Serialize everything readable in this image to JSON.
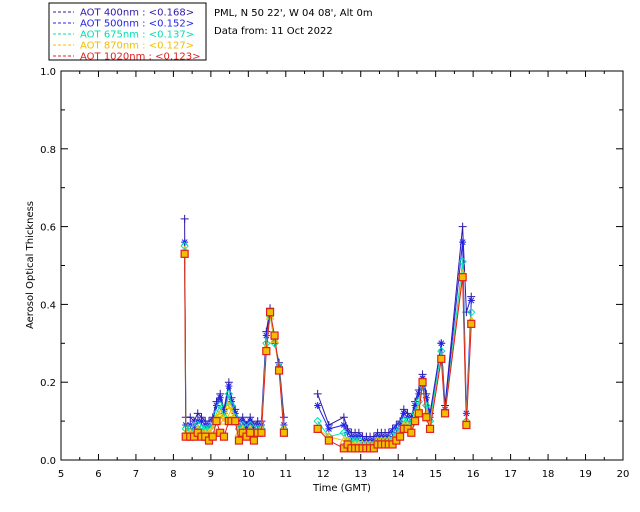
{
  "chart_data": {
    "type": "line",
    "header": {
      "line1": "PML, N 50 22', W 04 08', Alt 0m",
      "line2": "Data from: 11 Oct 2022"
    },
    "xlabel": "Time (GMT)",
    "ylabel": "Aerosol Optical Thickness",
    "xlim": [
      5,
      20
    ],
    "ylim": [
      0,
      1.0
    ],
    "xticks": [
      5,
      6,
      7,
      8,
      9,
      10,
      11,
      12,
      13,
      14,
      15,
      16,
      17,
      18,
      19,
      20
    ],
    "yticks": [
      "0.0",
      "0.2",
      "0.4",
      "0.6",
      "0.8",
      "1.0"
    ],
    "grid": false,
    "legend_position": "top-left outside",
    "series": [
      {
        "name": "AOT  400nm : <0.168>",
        "color": "#2d1aa8",
        "marker": "plus",
        "x": [
          8.3,
          8.33,
          8.45,
          8.55,
          8.65,
          8.75,
          8.85,
          8.95,
          9.05,
          9.15,
          9.25,
          9.35,
          9.48,
          9.55,
          9.65,
          9.75,
          9.85,
          9.95,
          10.05,
          10.15,
          10.25,
          10.35,
          10.48,
          10.58,
          10.7,
          10.82,
          10.95,
          11.85,
          12.15,
          12.55,
          12.65,
          12.75,
          12.85,
          12.95,
          13.05,
          13.15,
          13.25,
          13.35,
          13.45,
          13.55,
          13.65,
          13.75,
          13.85,
          13.95,
          14.05,
          14.15,
          14.25,
          14.35,
          14.45,
          14.55,
          14.65,
          14.75,
          14.85,
          15.15,
          15.25,
          15.72,
          15.82,
          15.95
        ],
        "y": [
          0.62,
          0.11,
          0.11,
          0.1,
          0.12,
          0.11,
          0.1,
          0.1,
          0.11,
          0.15,
          0.17,
          0.13,
          0.2,
          0.16,
          0.13,
          0.1,
          0.11,
          0.09,
          0.11,
          0.09,
          0.1,
          0.1,
          0.33,
          0.39,
          0.3,
          0.25,
          0.11,
          0.17,
          0.09,
          0.11,
          0.08,
          0.07,
          0.07,
          0.07,
          0.06,
          0.06,
          0.06,
          0.06,
          0.07,
          0.07,
          0.07,
          0.07,
          0.08,
          0.09,
          0.1,
          0.13,
          0.12,
          0.11,
          0.15,
          0.18,
          0.22,
          0.17,
          0.12,
          0.3,
          0.14,
          0.6,
          0.38,
          0.42
        ]
      },
      {
        "name": "AOT  500nm : <0.152>",
        "color": "#2424e8",
        "marker": "star",
        "x": [
          8.3,
          8.33,
          8.45,
          8.55,
          8.65,
          8.75,
          8.85,
          8.95,
          9.05,
          9.15,
          9.25,
          9.35,
          9.48,
          9.55,
          9.65,
          9.75,
          9.85,
          9.95,
          10.05,
          10.15,
          10.25,
          10.35,
          10.48,
          10.58,
          10.7,
          10.82,
          10.95,
          11.85,
          12.15,
          12.55,
          12.65,
          12.75,
          12.85,
          12.95,
          13.05,
          13.15,
          13.25,
          13.35,
          13.45,
          13.55,
          13.65,
          13.75,
          13.85,
          13.95,
          14.05,
          14.15,
          14.25,
          14.35,
          14.45,
          14.55,
          14.65,
          14.75,
          14.85,
          15.15,
          15.25,
          15.72,
          15.82,
          15.95
        ],
        "y": [
          0.56,
          0.09,
          0.09,
          0.08,
          0.1,
          0.1,
          0.09,
          0.09,
          0.1,
          0.14,
          0.16,
          0.12,
          0.19,
          0.15,
          0.12,
          0.09,
          0.1,
          0.08,
          0.1,
          0.08,
          0.09,
          0.09,
          0.32,
          0.38,
          0.31,
          0.24,
          0.09,
          0.14,
          0.08,
          0.09,
          0.07,
          0.06,
          0.06,
          0.06,
          0.05,
          0.05,
          0.05,
          0.05,
          0.06,
          0.06,
          0.06,
          0.06,
          0.07,
          0.08,
          0.09,
          0.12,
          0.11,
          0.1,
          0.14,
          0.17,
          0.21,
          0.16,
          0.11,
          0.3,
          0.13,
          0.56,
          0.12,
          0.41
        ]
      },
      {
        "name": "AOT  675nm : <0.137>",
        "color": "#00e0b0",
        "marker": "diamond",
        "x": [
          8.3,
          8.33,
          8.45,
          8.55,
          8.65,
          8.75,
          8.85,
          8.95,
          9.05,
          9.15,
          9.25,
          9.35,
          9.48,
          9.55,
          9.65,
          9.75,
          9.85,
          9.95,
          10.05,
          10.15,
          10.25,
          10.35,
          10.48,
          10.58,
          10.7,
          10.82,
          10.95,
          11.85,
          12.15,
          12.55,
          12.65,
          12.75,
          12.85,
          12.95,
          13.05,
          13.15,
          13.25,
          13.35,
          13.45,
          13.55,
          13.65,
          13.75,
          13.85,
          13.95,
          14.05,
          14.15,
          14.25,
          14.35,
          14.45,
          14.55,
          14.65,
          14.75,
          14.85,
          15.15,
          15.25,
          15.72,
          15.82,
          15.95
        ],
        "y": [
          0.55,
          0.08,
          0.08,
          0.07,
          0.09,
          0.08,
          0.08,
          0.08,
          0.09,
          0.12,
          0.14,
          0.11,
          0.17,
          0.14,
          0.11,
          0.08,
          0.09,
          0.07,
          0.09,
          0.07,
          0.08,
          0.08,
          0.3,
          0.37,
          0.3,
          0.24,
          0.08,
          0.1,
          0.06,
          0.07,
          0.05,
          0.05,
          0.05,
          0.05,
          0.04,
          0.04,
          0.04,
          0.04,
          0.05,
          0.05,
          0.05,
          0.05,
          0.06,
          0.07,
          0.08,
          0.1,
          0.1,
          0.09,
          0.12,
          0.15,
          0.19,
          0.14,
          0.1,
          0.28,
          0.12,
          0.51,
          0.1,
          0.38
        ]
      },
      {
        "name": "AOT  870nm : <0.127>",
        "color": "#f0c000",
        "marker": "triangle",
        "x": [
          8.3,
          8.33,
          8.45,
          8.55,
          8.65,
          8.75,
          8.85,
          8.95,
          9.05,
          9.15,
          9.25,
          9.35,
          9.48,
          9.55,
          9.65,
          9.75,
          9.85,
          9.95,
          10.05,
          10.15,
          10.25,
          10.35,
          10.48,
          10.58,
          10.7,
          10.82,
          10.95,
          11.85,
          12.15,
          12.55,
          12.65,
          12.75,
          12.85,
          12.95,
          13.05,
          13.15,
          13.25,
          13.35,
          13.45,
          13.55,
          13.65,
          13.75,
          13.85,
          13.95,
          14.05,
          14.15,
          14.25,
          14.35,
          14.45,
          14.55,
          14.65,
          14.75,
          14.85,
          15.15,
          15.25,
          15.72,
          15.82,
          15.95
        ],
        "y": [
          0.54,
          0.07,
          0.07,
          0.07,
          0.08,
          0.07,
          0.07,
          0.07,
          0.08,
          0.11,
          0.12,
          0.1,
          0.14,
          0.12,
          0.1,
          0.07,
          0.08,
          0.07,
          0.08,
          0.07,
          0.07,
          0.08,
          0.29,
          0.37,
          0.31,
          0.23,
          0.08,
          0.08,
          0.06,
          0.05,
          0.05,
          0.04,
          0.04,
          0.04,
          0.04,
          0.04,
          0.04,
          0.04,
          0.05,
          0.05,
          0.05,
          0.05,
          0.05,
          0.06,
          0.07,
          0.09,
          0.09,
          0.08,
          0.11,
          0.13,
          0.2,
          0.12,
          0.09,
          0.26,
          0.12,
          0.48,
          0.1,
          0.36
        ]
      },
      {
        "name": "AOT 1020nm : <0.123>",
        "color": "#e02020",
        "marker": "square",
        "x": [
          8.3,
          8.33,
          8.45,
          8.55,
          8.65,
          8.75,
          8.85,
          8.95,
          9.05,
          9.15,
          9.25,
          9.35,
          9.48,
          9.55,
          9.65,
          9.75,
          9.85,
          9.95,
          10.05,
          10.15,
          10.25,
          10.35,
          10.48,
          10.58,
          10.7,
          10.82,
          10.95,
          11.85,
          12.15,
          12.55,
          12.65,
          12.75,
          12.85,
          12.95,
          13.05,
          13.15,
          13.25,
          13.35,
          13.45,
          13.55,
          13.65,
          13.75,
          13.85,
          13.95,
          14.05,
          14.15,
          14.25,
          14.35,
          14.45,
          14.55,
          14.65,
          14.75,
          14.85,
          15.15,
          15.25,
          15.72,
          15.82,
          15.95
        ],
        "y": [
          0.53,
          0.06,
          0.06,
          0.06,
          0.07,
          0.06,
          0.06,
          0.05,
          0.06,
          0.1,
          0.07,
          0.06,
          0.1,
          0.1,
          0.1,
          0.05,
          0.07,
          0.06,
          0.07,
          0.05,
          0.07,
          0.07,
          0.28,
          0.38,
          0.32,
          0.23,
          0.07,
          0.08,
          0.05,
          0.03,
          0.04,
          0.03,
          0.03,
          0.03,
          0.03,
          0.03,
          0.03,
          0.03,
          0.04,
          0.04,
          0.04,
          0.04,
          0.04,
          0.05,
          0.06,
          0.08,
          0.08,
          0.07,
          0.1,
          0.12,
          0.2,
          0.11,
          0.08,
          0.26,
          0.12,
          0.47,
          0.09,
          0.35
        ]
      }
    ]
  }
}
